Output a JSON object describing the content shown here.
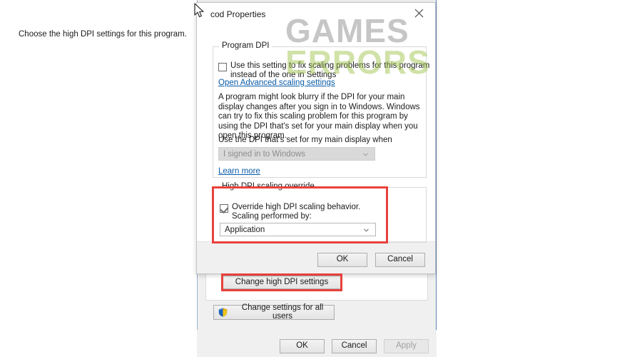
{
  "background_window": {
    "change_dpi_button": "Change high DPI settings",
    "change_all_users_button": "Change settings for all users",
    "shield_icon": "shield-icon",
    "footer": {
      "ok": "OK",
      "cancel": "Cancel",
      "apply": "Apply",
      "apply_disabled": true
    }
  },
  "watermark": {
    "line1": "GAMES",
    "line2": "ERRORS",
    "color1": "#787878",
    "color2": "#96be3c"
  },
  "dialog": {
    "title": "cod Properties",
    "close_icon": "close-icon",
    "intro": "Choose the high DPI settings for this program.",
    "program_dpi": {
      "group_title": "Program DPI",
      "checkbox": {
        "checked": false,
        "label_line1": "Use this setting to fix scaling problems for this program",
        "label_line2": "instead of the one in Settings"
      },
      "advanced_link": "Open Advanced scaling settings",
      "description": "A program might look blurry if the DPI for your main display changes after you sign in to Windows. Windows can try to fix this scaling problem for this program by using the DPI that's set for your main display when you open this program.",
      "combo_label": "Use the DPI that's set for my main display when",
      "combo_value": "I signed in to Windows",
      "combo_disabled": true,
      "combo_caret_icon": "chevron-down-icon",
      "learn_more_link": "Learn more"
    },
    "high_dpi_override": {
      "group_title": "High DPI scaling override",
      "checkbox": {
        "checked": true,
        "label_line1": "Override high DPI scaling behavior.",
        "label_line2": "Scaling performed by:"
      },
      "combo_value": "Application",
      "combo_caret_icon": "chevron-down-icon"
    },
    "footer": {
      "ok": "OK",
      "cancel": "Cancel"
    }
  },
  "annotations": {
    "highlight_color": "#e8413c",
    "boxes": [
      "high-dpi-scaling-override",
      "change-high-dpi-settings"
    ]
  },
  "cursor": {
    "icon": "mouse-pointer-icon"
  }
}
